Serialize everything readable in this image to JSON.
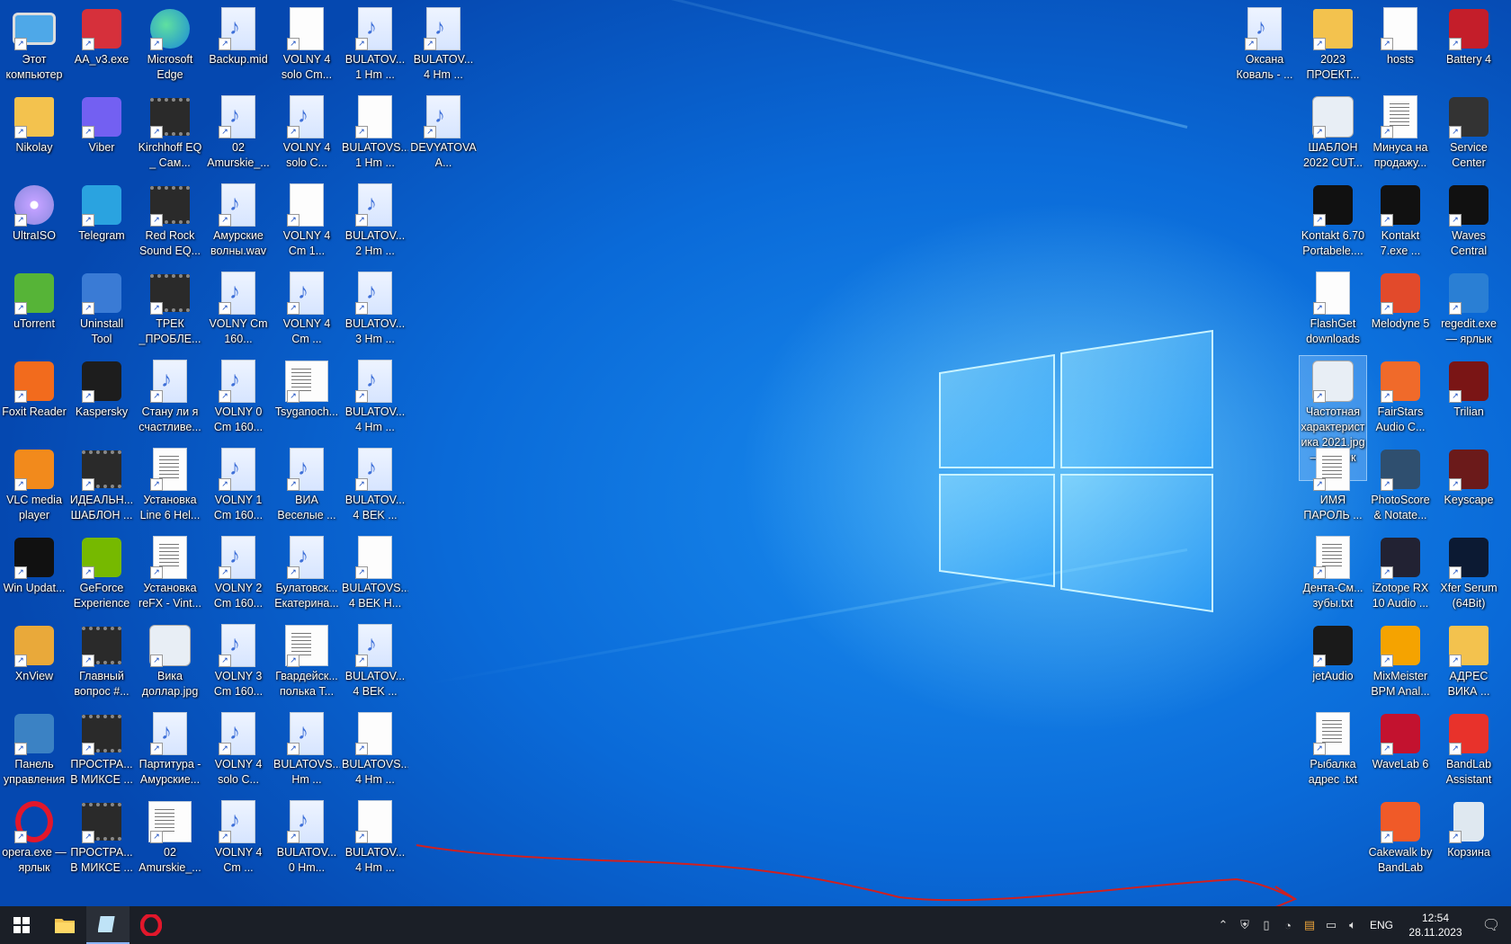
{
  "desktop": {
    "left_columns": [
      [
        {
          "label": "Этот компьютер",
          "icon": "computer-icon"
        },
        {
          "label": "Nikolay",
          "icon": "user-folder-icon"
        },
        {
          "label": "UltraISO",
          "icon": "disc-icon"
        },
        {
          "label": "uTorrent",
          "icon": "utorrent-icon"
        },
        {
          "label": "Foxit Reader",
          "icon": "foxit-icon"
        },
        {
          "label": "VLC media player",
          "icon": "vlc-icon"
        },
        {
          "label": "Win Updat...",
          "icon": "win-update-icon"
        },
        {
          "label": "XnView",
          "icon": "xnview-icon"
        },
        {
          "label": "Панель управления",
          "icon": "control-panel-icon"
        },
        {
          "label": "opera.exe — ярлык",
          "icon": "opera-icon"
        }
      ],
      [
        {
          "label": "AA_v3.exe",
          "icon": "aa-icon"
        },
        {
          "label": "Viber",
          "icon": "viber-icon"
        },
        {
          "label": "Telegram",
          "icon": "telegram-icon"
        },
        {
          "label": "Uninstall Tool",
          "icon": "uninstall-tool-icon"
        },
        {
          "label": "Kaspersky",
          "icon": "kaspersky-icon"
        },
        {
          "label": "ИДЕАЛЬН... ШАБЛОН ...",
          "icon": "video-icon"
        },
        {
          "label": "GeForce Experience",
          "icon": "geforce-icon"
        },
        {
          "label": "Главный вопрос #...",
          "icon": "video-icon"
        },
        {
          "label": "ПРОСТРА... В МИКСЕ ...",
          "icon": "video-icon"
        },
        {
          "label": "ПРОСТРА... В МИКСЕ ...",
          "icon": "video-icon"
        }
      ],
      [
        {
          "label": "Microsoft Edge",
          "icon": "edge-icon"
        },
        {
          "label": "Kirchhoff EQ _ Сам...",
          "icon": "video-icon"
        },
        {
          "label": "Red Rock Sound EQ...",
          "icon": "video-icon"
        },
        {
          "label": "ТРЕК _ПРОБЛЕ...",
          "icon": "video-icon"
        },
        {
          "label": "Стану ли я счастливе...",
          "icon": "audio-file-icon"
        },
        {
          "label": "Установка Line 6 Hel...",
          "icon": "text-file-icon"
        },
        {
          "label": "Установка reFX - Vint...",
          "icon": "text-file-icon"
        },
        {
          "label": "Вика доллар.jpg",
          "icon": "image-icon"
        },
        {
          "label": "Партитура - Амурские...",
          "icon": "audio-file-icon"
        },
        {
          "label": "02 Amurskie_...",
          "icon": "score-icon"
        }
      ],
      [
        {
          "label": "Backup.mid",
          "icon": "audio-file-icon"
        },
        {
          "label": "02 Amurskie_...",
          "icon": "audio-file-icon"
        },
        {
          "label": "Амурские волны.wav",
          "icon": "audio-file-icon"
        },
        {
          "label": "VOLNY Cm 160...",
          "icon": "audio-file-icon"
        },
        {
          "label": "VOLNY 0 Cm 160...",
          "icon": "audio-file-icon"
        },
        {
          "label": "VOLNY 1 Cm 160...",
          "icon": "audio-file-icon"
        },
        {
          "label": "VOLNY 2 Cm 160...",
          "icon": "audio-file-icon"
        },
        {
          "label": "VOLNY 3 Cm 160...",
          "icon": "audio-file-icon"
        },
        {
          "label": "VOLNY 4 solo C...",
          "icon": "audio-file-icon"
        },
        {
          "label": "VOLNY 4 Cm ...",
          "icon": "audio-file-icon"
        }
      ],
      [
        {
          "label": "VOLNY 4 solo Cm...",
          "icon": "blank-file-icon"
        },
        {
          "label": "VOLNY 4 solo C...",
          "icon": "audio-file-icon"
        },
        {
          "label": "VOLNY 4 Cm 1...",
          "icon": "blank-file-icon"
        },
        {
          "label": "VOLNY 4 Cm ...",
          "icon": "audio-file-icon"
        },
        {
          "label": "Tsyganoch...",
          "icon": "score-icon"
        },
        {
          "label": "ВИА Веселые ...",
          "icon": "audio-file-icon"
        },
        {
          "label": "Булатовск... Екатерина...",
          "icon": "audio-file-icon"
        },
        {
          "label": "Гвардейск... полька T...",
          "icon": "score-icon"
        },
        {
          "label": "BULATOVS... Hm ...",
          "icon": "audio-file-icon"
        },
        {
          "label": "BULATOV... 0 Hm...",
          "icon": "audio-file-icon"
        }
      ],
      [
        {
          "label": "BULATOV... 1 Hm ...",
          "icon": "audio-file-icon"
        },
        {
          "label": "BULATOVS... 1 Hm ...",
          "icon": "blank-file-icon"
        },
        {
          "label": "BULATOV... 2 Hm ...",
          "icon": "audio-file-icon"
        },
        {
          "label": "BULATOV... 3 Hm ...",
          "icon": "audio-file-icon"
        },
        {
          "label": "BULATOV... 4 Hm ...",
          "icon": "audio-file-icon"
        },
        {
          "label": "BULATOV... 4 BEK ...",
          "icon": "audio-file-icon"
        },
        {
          "label": "BULATOVS... 4 BEK H...",
          "icon": "blank-file-icon"
        },
        {
          "label": "BULATOV... 4 BEK ...",
          "icon": "audio-file-icon"
        },
        {
          "label": "BULATOVS... 4 Hm ...",
          "icon": "blank-file-icon"
        },
        {
          "label": "BULATOV... 4 Hm ...",
          "icon": "blank-file-icon"
        }
      ],
      [
        {
          "label": "BULATOV... 4 Hm ...",
          "icon": "audio-file-icon"
        },
        {
          "label": "DEVYATOVA A...",
          "icon": "audio-file-icon"
        }
      ]
    ],
    "right_columns": [
      [
        {
          "label": "Оксана Коваль - ...",
          "icon": "audio-file-icon"
        }
      ],
      [
        {
          "label": "2023 ПРОЕКТ...",
          "icon": "folder-icon"
        },
        {
          "label": "ШАБЛОН 2022 CUT...",
          "icon": "image-icon"
        },
        {
          "label": "Kontakt 6.70 Portabele....",
          "icon": "kontakt-icon"
        },
        {
          "label": "FlashGet downloads",
          "icon": "blank-file-icon"
        },
        {
          "label": "Частотная характерист ика 2021.jpg — ярлык",
          "icon": "image-icon",
          "selected": true
        },
        {
          "label": "ИМЯ ПАРОЛЬ ...",
          "icon": "text-file-icon"
        },
        {
          "label": "Дента-См... зубы.txt",
          "icon": "text-file-icon"
        },
        {
          "label": "jetAudio",
          "icon": "jetaudio-icon"
        },
        {
          "label": "Рыбалка адрес .txt",
          "icon": "text-file-icon"
        }
      ],
      [
        {
          "label": "hosts",
          "icon": "blank-file-icon"
        },
        {
          "label": "Минуса на продажу...",
          "icon": "text-file-icon"
        },
        {
          "label": "Kontakt 7.exe ...",
          "icon": "kontakt7-icon"
        },
        {
          "label": "Melodyne 5",
          "icon": "melodyne-icon"
        },
        {
          "label": "FairStars Audio C...",
          "icon": "fairstars-icon"
        },
        {
          "label": "PhotoScore & Notate...",
          "icon": "photoscore-icon"
        },
        {
          "label": "iZotope RX 10 Audio ...",
          "icon": "izotope-icon"
        },
        {
          "label": "MixMeister BPM Anal...",
          "icon": "mixmeister-icon"
        },
        {
          "label": "WaveLab 6",
          "icon": "wavelab-icon"
        },
        {
          "label": "Cakewalk by BandLab",
          "icon": "cakewalk-icon"
        }
      ],
      [
        {
          "label": "Battery 4",
          "icon": "battery-icon"
        },
        {
          "label": "Service Center",
          "icon": "service-center-icon"
        },
        {
          "label": "Waves Central",
          "icon": "waves-icon"
        },
        {
          "label": "regedit.exe — ярлык",
          "icon": "regedit-icon"
        },
        {
          "label": "Trilian",
          "icon": "trilian-icon"
        },
        {
          "label": "Keyscape",
          "icon": "keyscape-icon"
        },
        {
          "label": "Xfer Serum (64Bit)",
          "icon": "xfer-icon"
        },
        {
          "label": "АДРЕС ВИКА ...",
          "icon": "folder-icon"
        },
        {
          "label": "BandLab Assistant",
          "icon": "bandlab-icon"
        },
        {
          "label": "Корзина",
          "icon": "recycle-bin-icon"
        }
      ]
    ]
  },
  "taskbar": {
    "buttons": [
      {
        "name": "start-button",
        "icon": "windows-icon"
      },
      {
        "name": "file-explorer-button",
        "icon": "folder-icon"
      },
      {
        "name": "app-button",
        "icon": "notepad-icon"
      },
      {
        "name": "opera-button",
        "icon": "opera-icon"
      }
    ],
    "tray": {
      "language": "ENG",
      "time": "12:54",
      "date": "28.11.2023"
    }
  },
  "colors": {
    "desktop": "#0a6ad8",
    "taskbar": "#1b1f27",
    "annotation_line": "#d02020"
  }
}
